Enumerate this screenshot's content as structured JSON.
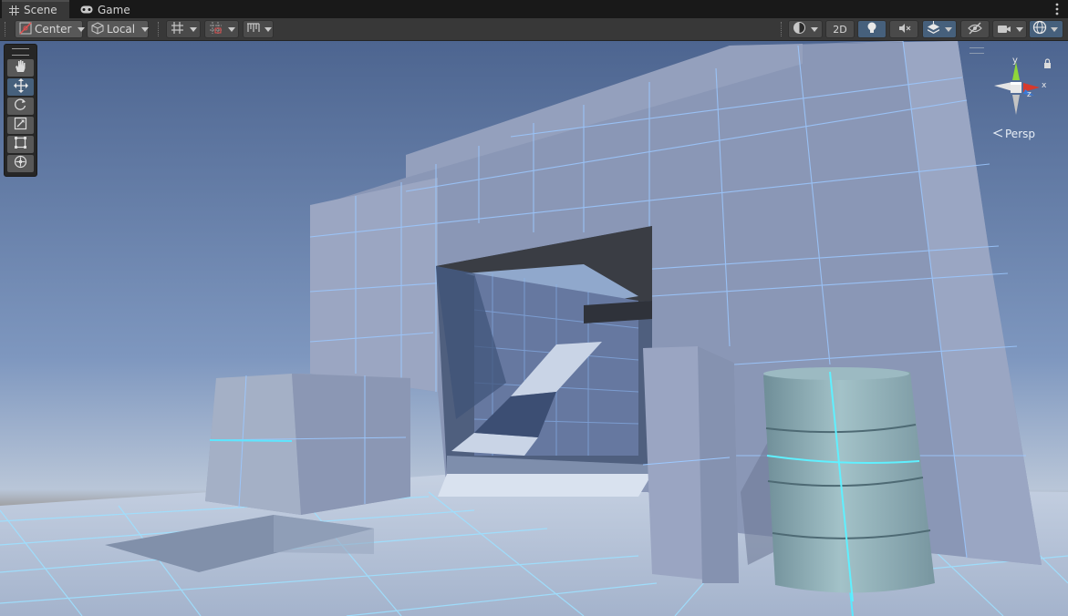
{
  "tabs": [
    {
      "label": "Scene",
      "icon": "grid-icon",
      "active": true
    },
    {
      "label": "Game",
      "icon": "gamepad-icon",
      "active": false
    }
  ],
  "toolbar": {
    "pivot_label": "Center",
    "space_label": "Local",
    "mode_2d_label": "2D"
  },
  "tools": [
    {
      "name": "hand-tool",
      "icon": "hand-icon"
    },
    {
      "name": "move-tool",
      "icon": "move-icon",
      "active": true
    },
    {
      "name": "rotate-tool",
      "icon": "rotate-icon"
    },
    {
      "name": "scale-tool",
      "icon": "scale-icon"
    },
    {
      "name": "rect-tool",
      "icon": "rect-transform-icon"
    },
    {
      "name": "transform-tool",
      "icon": "transform-icon"
    }
  ],
  "gizmo": {
    "y_label": "y",
    "z_label": "z",
    "projection_label": "Persp",
    "colors": {
      "x": "#d63a2c",
      "y": "#8fd63a",
      "z": "#3a7ad6"
    }
  },
  "colors": {
    "accent": "#46607c",
    "grid_line": "#8fd8ff",
    "wall": "#8e99b8",
    "barrel": "#8fb0b8"
  }
}
